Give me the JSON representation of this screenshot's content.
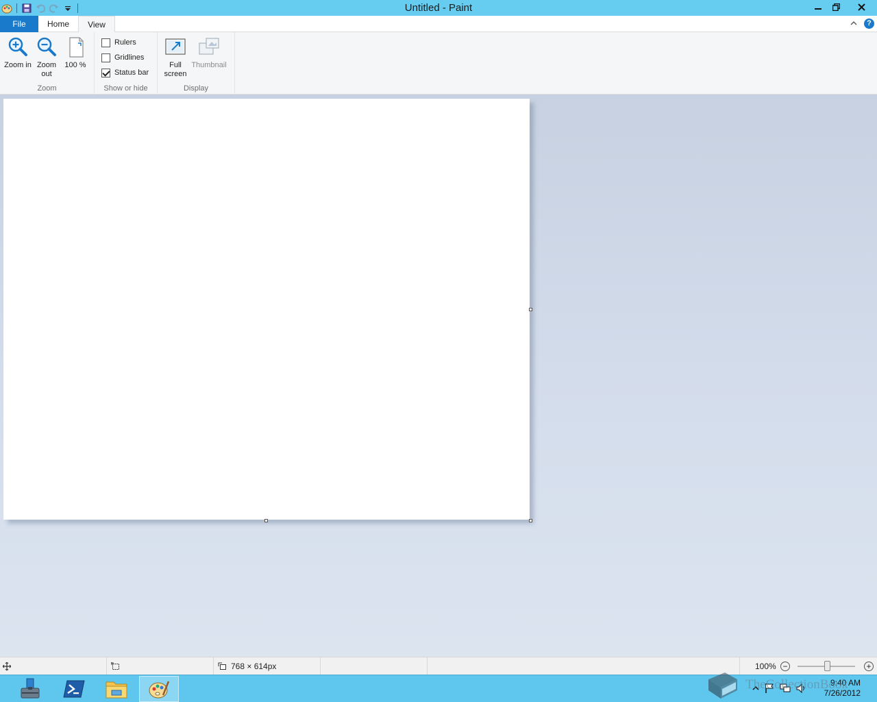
{
  "window": {
    "title": "Untitled - Paint"
  },
  "tabs": {
    "file": "File",
    "home": "Home",
    "view": "View"
  },
  "ribbon": {
    "help": "?",
    "zoom_group": {
      "label": "Zoom",
      "zoom_in": "Zoom in",
      "zoom_out": "Zoom out",
      "actual_size": "100 %"
    },
    "show_hide_group": {
      "label": "Show or hide",
      "rulers": {
        "label": "Rulers",
        "checked": false
      },
      "gridlines": {
        "label": "Gridlines",
        "checked": false
      },
      "status_bar": {
        "label": "Status bar",
        "checked": true
      }
    },
    "display_group": {
      "label": "Display",
      "full_screen": "Full screen",
      "thumbnail": "Thumbnail"
    }
  },
  "statusbar": {
    "image_size": "768 × 614px",
    "zoom_level": "100%",
    "zoom_minus": "−",
    "zoom_plus": "+"
  },
  "taskbar": {
    "clock_time": "9:40 AM",
    "clock_date": "7/26/2012",
    "apps": [
      "server-manager-icon",
      "powershell-icon",
      "file-explorer-icon",
      "paint-icon"
    ]
  },
  "watermark": {
    "text": "TheCollectionBook"
  },
  "colors": {
    "titlebar": "#66cdf0",
    "file_tab": "#1979ca",
    "taskbar": "#5fc6ee"
  }
}
